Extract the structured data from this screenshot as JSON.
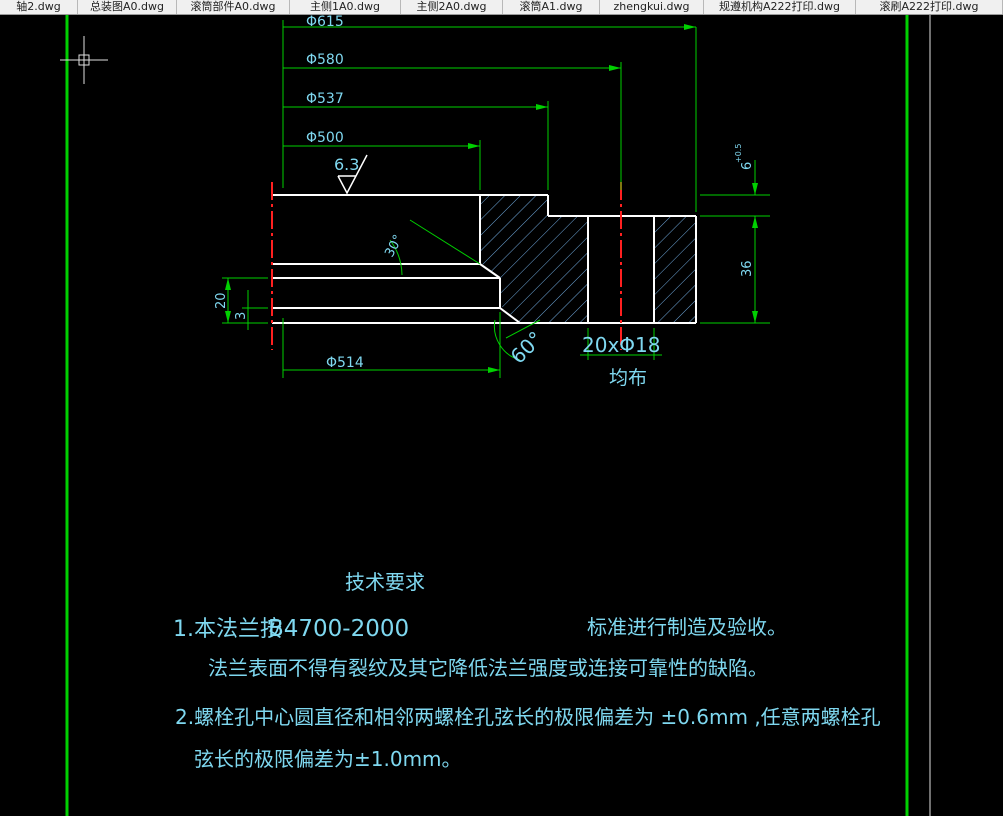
{
  "tabs": [
    {
      "label": "轴2.dwg"
    },
    {
      "label": "总装图A0.dwg"
    },
    {
      "label": "滚筒部件A0.dwg"
    },
    {
      "label": "主侧1A0.dwg"
    },
    {
      "label": "主侧2A0.dwg"
    },
    {
      "label": "滚筒A1.dwg"
    },
    {
      "label": "zhengkui.dwg"
    },
    {
      "label": "规遵机构A222打印.dwg"
    },
    {
      "label": "滚刷A222打印.dwg"
    }
  ],
  "drawing": {
    "dimensions": {
      "d615": "Φ615",
      "d580": "Φ580",
      "d537": "Φ537",
      "d500": "Φ500",
      "d514": "Φ514",
      "roughness": "6.3",
      "angle30": "30°",
      "angle60": "60°",
      "height20": "20",
      "height3": "3",
      "height36": "36",
      "thickness6": "6",
      "tolerance6": "+0.5",
      "holes": "20xΦ18",
      "distribution": "均布"
    },
    "tech_requirements": {
      "title": "技术要求",
      "line1a": "1.本法兰按",
      "line1b": "B4700-2000",
      "line1c": "标准进行制造及验收。",
      "line2": "法兰表面不得有裂纹及其它降低法兰强度或连接可靠性的缺陷。",
      "line3": "2.螺栓孔中心圆直径和相邻两螺栓孔弦长的极限偏差为 ±0.6mm ,任意两螺栓孔",
      "line4": "弦长的极限偏差为±1.0mm。"
    }
  },
  "colors": {
    "border": "#00d000",
    "outline": "#ffffff",
    "dimension": "#00d000",
    "centerline": "#ff2020",
    "hatch": "#6fa8dc",
    "text": "#7fd8f0"
  }
}
